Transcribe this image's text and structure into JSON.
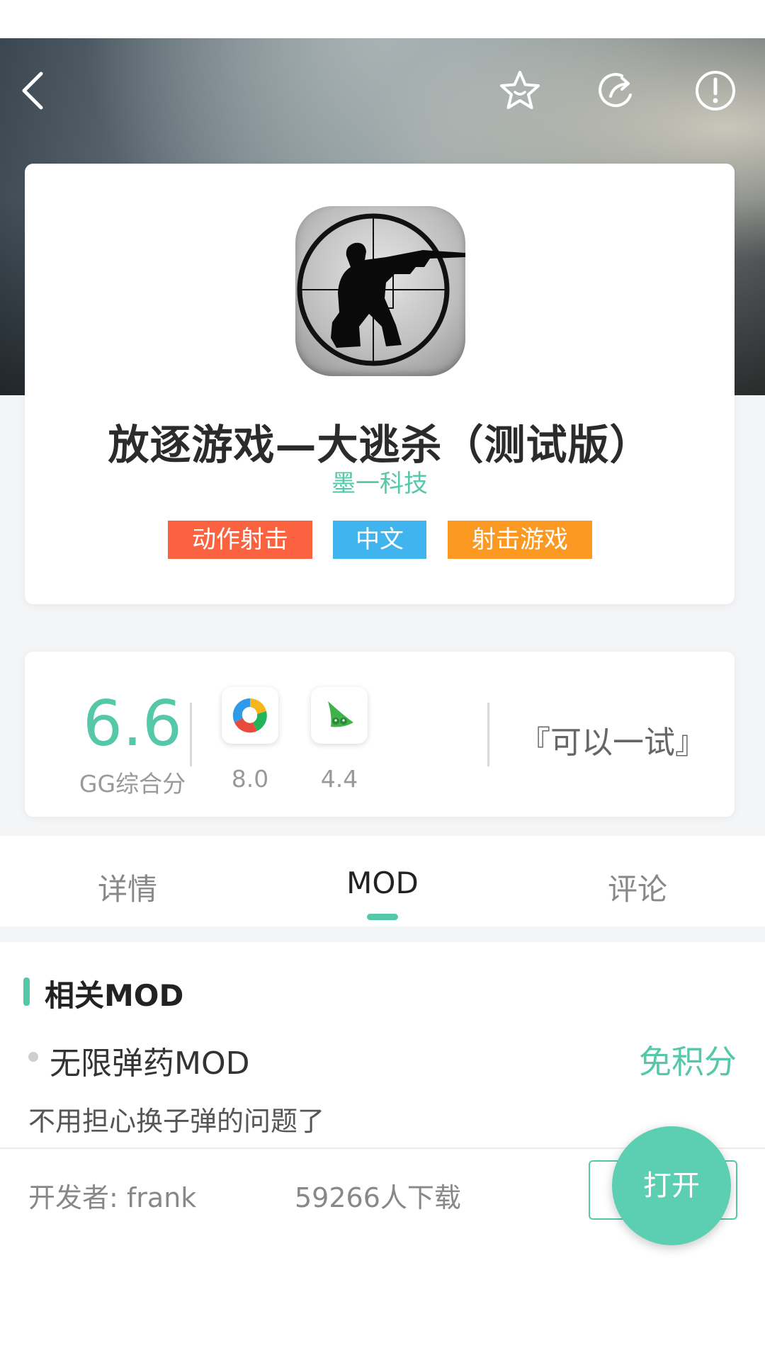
{
  "app": {
    "title": "放逐游戏—大逃杀（测试版）",
    "developer": "墨一科技",
    "tags": [
      {
        "label": "动作射击",
        "color": "#fb6240"
      },
      {
        "label": "中文",
        "color": "#3fb4ee"
      },
      {
        "label": "射击游戏",
        "color": "#fb9923"
      }
    ]
  },
  "header": {
    "icons": [
      "back-icon",
      "favorite-star-icon",
      "share-icon",
      "report-icon"
    ]
  },
  "rating": {
    "overall_score": "6.6",
    "overall_label": "GG综合分",
    "stores": [
      {
        "icon": "store-icon-color-ring",
        "score": "8.0"
      },
      {
        "icon": "store-icon-green-pea",
        "score": "4.4"
      }
    ],
    "verdict": "『可以一试』"
  },
  "tabs": {
    "items": [
      "详情",
      "MOD",
      "评论"
    ],
    "active": "MOD"
  },
  "mod_section": {
    "title": "相关MOD",
    "mod": {
      "name": "无限弹药MOD",
      "price": "免积分",
      "description": "不用担心换子弹的问题了",
      "developer": "开发者: frank",
      "downloads": "59266人下载"
    }
  },
  "fab": {
    "label": "打开"
  },
  "colors": {
    "accent": "#54c8a8",
    "tag_action": "#fb6240",
    "tag_language": "#3fb4ee",
    "tag_genre": "#fb9923"
  }
}
